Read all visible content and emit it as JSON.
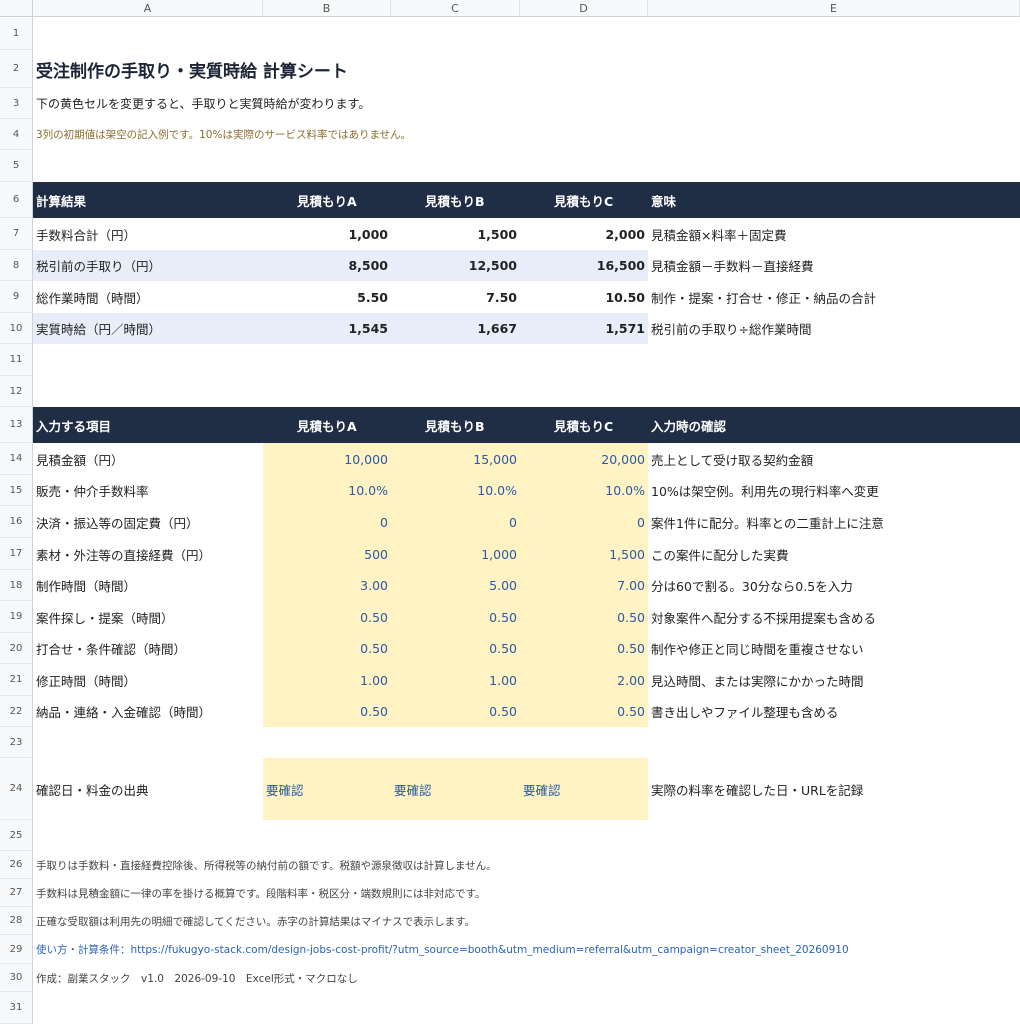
{
  "columns": [
    "A",
    "B",
    "C",
    "D",
    "E"
  ],
  "rows": [
    "1",
    "2",
    "3",
    "4",
    "5",
    "6",
    "7",
    "8",
    "9",
    "10",
    "11",
    "12",
    "13",
    "14",
    "15",
    "16",
    "17",
    "18",
    "19",
    "20",
    "21",
    "22",
    "23",
    "24",
    "25",
    "26",
    "27",
    "28",
    "29",
    "30",
    "31"
  ],
  "title": "受注制作の手取り・実質時給 計算シート",
  "subtitle": "下の黄色セルを変更すると、手取りと実質時給が変わります。",
  "note_sample": "3列の初期値は架空の記入例です。10%は実際のサービス料率ではありません。",
  "results": {
    "header": [
      "計算結果",
      "見積もりA",
      "見積もりB",
      "見積もりC",
      "意味"
    ],
    "rows": [
      {
        "label": "手数料合計（円）",
        "a": "1,000",
        "b": "1,500",
        "c": "2,000",
        "meaning": "見積金額×料率＋固定費"
      },
      {
        "label": "税引前の手取り（円）",
        "a": "8,500",
        "b": "12,500",
        "c": "16,500",
        "meaning": "見積金額－手数料－直接経費"
      },
      {
        "label": "総作業時間（時間）",
        "a": "5.50",
        "b": "7.50",
        "c": "10.50",
        "meaning": "制作・提案・打合せ・修正・納品の合計"
      },
      {
        "label": "実質時給（円／時間）",
        "a": "1,545",
        "b": "1,667",
        "c": "1,571",
        "meaning": "税引前の手取り÷総作業時間"
      }
    ]
  },
  "inputs": {
    "header": [
      "入力する項目",
      "見積もりA",
      "見積もりB",
      "見積もりC",
      "入力時の確認"
    ],
    "rows": [
      {
        "label": "見積金額（円）",
        "a": "10,000",
        "b": "15,000",
        "c": "20,000",
        "check": "売上として受け取る契約金額"
      },
      {
        "label": "販売・仲介手数料率",
        "a": "10.0%",
        "b": "10.0%",
        "c": "10.0%",
        "check": "10%は架空例。利用先の現行料率へ変更"
      },
      {
        "label": "決済・振込等の固定費（円）",
        "a": "0",
        "b": "0",
        "c": "0",
        "check": "案件1件に配分。料率との二重計上に注意"
      },
      {
        "label": "素材・外注等の直接経費（円）",
        "a": "500",
        "b": "1,000",
        "c": "1,500",
        "check": "この案件に配分した実費"
      },
      {
        "label": "制作時間（時間）",
        "a": "3.00",
        "b": "5.00",
        "c": "7.00",
        "check": "分は60で割る。30分なら0.5を入力"
      },
      {
        "label": "案件探し・提案（時間）",
        "a": "0.50",
        "b": "0.50",
        "c": "0.50",
        "check": "対象案件へ配分する不採用提案も含める"
      },
      {
        "label": "打合せ・条件確認（時間）",
        "a": "0.50",
        "b": "0.50",
        "c": "0.50",
        "check": "制作や修正と同じ時間を重複させない"
      },
      {
        "label": "修正時間（時間）",
        "a": "1.00",
        "b": "1.00",
        "c": "2.00",
        "check": "見込時間、または実際にかかった時間"
      },
      {
        "label": "納品・連絡・入金確認（時間）",
        "a": "0.50",
        "b": "0.50",
        "c": "0.50",
        "check": "書き出しやファイル整理も含める"
      }
    ],
    "source": {
      "label": "確認日・料金の出典",
      "a": "要確認",
      "b": "要確認",
      "c": "要確認",
      "check": "実際の料率を確認した日・URLを記録"
    }
  },
  "footnotes": [
    "手取りは手数料・直接経費控除後、所得税等の納付前の額です。税額や源泉徴収は計算しません。",
    "手数料は見積金額に一律の率を掛ける概算です。段階料率・税区分・端数規則には非対応です。",
    "正確な受取額は利用先の明細で確認してください。赤字の計算結果はマイナスで表示します。"
  ],
  "usage_link": "使い方・計算条件：https://fukugyo-stack.com/design-jobs-cost-profit/?utm_source=booth&utm_medium=referral&utm_campaign=creator_sheet_20260910",
  "credit": "作成：副業スタック　v1.0　2026-09-10　Excel形式・マクロなし",
  "colors": {
    "header_bg": "#1f2d45",
    "band_bg": "#e8eef9",
    "input_bg": "#fff2c3",
    "input_text": "#2b5aa8"
  }
}
